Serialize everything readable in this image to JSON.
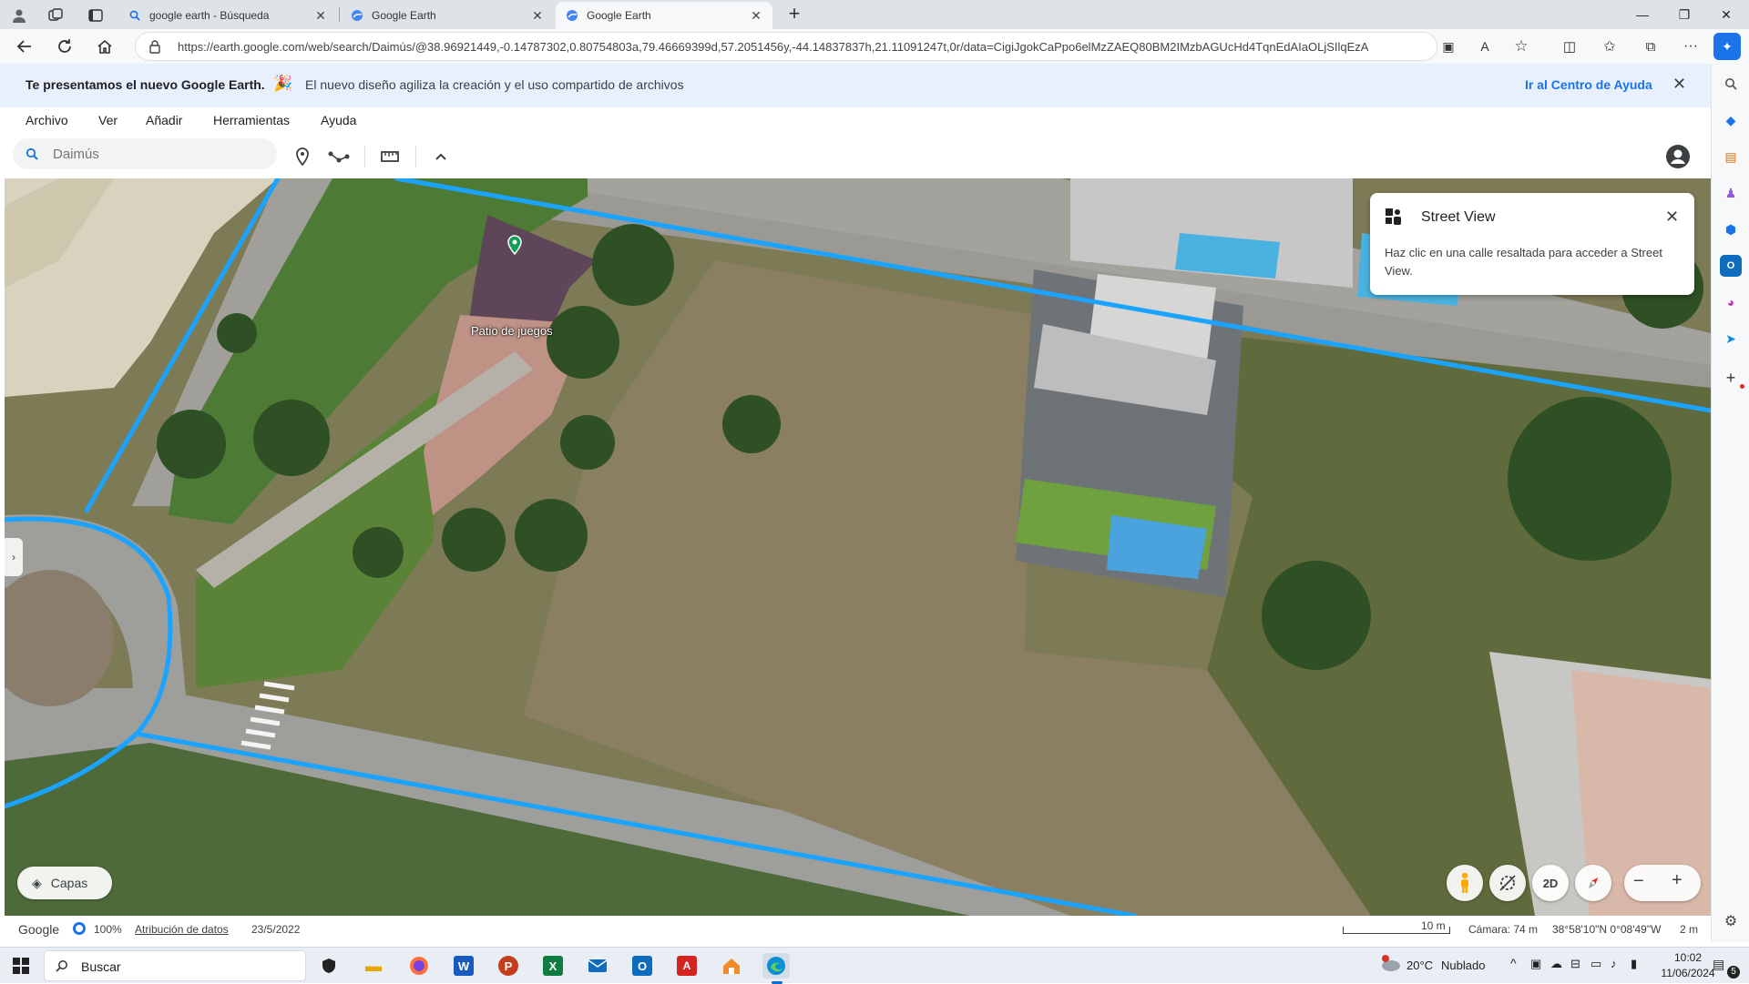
{
  "browser": {
    "tabs": [
      {
        "title": "google earth - Búsqueda",
        "icon": "search-icon"
      },
      {
        "title": "Google Earth",
        "icon": "google-earth-icon"
      },
      {
        "title": "Google Earth",
        "icon": "google-earth-icon",
        "active": true
      }
    ],
    "url": "https://earth.google.com/web/search/Daimús/@38.96921449,-0.14787302,0.80754803a,79.46669399d,57.2051456y,-44.14837837h,21.11091247t,0r/data=CigiJgokCaPpo6elMzZAEQ80BM2IMzbAGUcHd4TqnEdAIaOLjSIlqEzA"
  },
  "banner": {
    "title": "Te presentamos el nuevo Google Earth.",
    "emoji": "🎉",
    "message": "El nuevo diseño agiliza la creación y el uso compartido de archivos",
    "link": "Ir al Centro de Ayuda"
  },
  "menu": [
    "Archivo",
    "Ver",
    "Añadir",
    "Herramientas",
    "Ayuda"
  ],
  "search": {
    "placeholder": "Daimús"
  },
  "map": {
    "label": "Patio de juegos"
  },
  "street_view": {
    "title": "Street View",
    "text": "Haz clic en una calle resaltada para acceder a Street View."
  },
  "controls": {
    "layers": "Capas",
    "mode": "2D"
  },
  "status": {
    "brand": "Google",
    "zoom": "100%",
    "attribution": "Atribución de datos",
    "date": "23/5/2022",
    "scale": "10 m",
    "camera": "Cámara: 74 m",
    "coords": "38°58'10\"N 0°08'49\"W",
    "elevation": "2 m"
  },
  "taskbar": {
    "search": "Buscar",
    "weather_temp": "20°C",
    "weather_text": "Nublado",
    "time": "10:02",
    "date": "11/06/2024",
    "notifications": "5"
  },
  "colors": {
    "accent": "#1a73e8",
    "road_highlight": "#1aa3ff",
    "banner_bg": "#e8f0fe"
  }
}
